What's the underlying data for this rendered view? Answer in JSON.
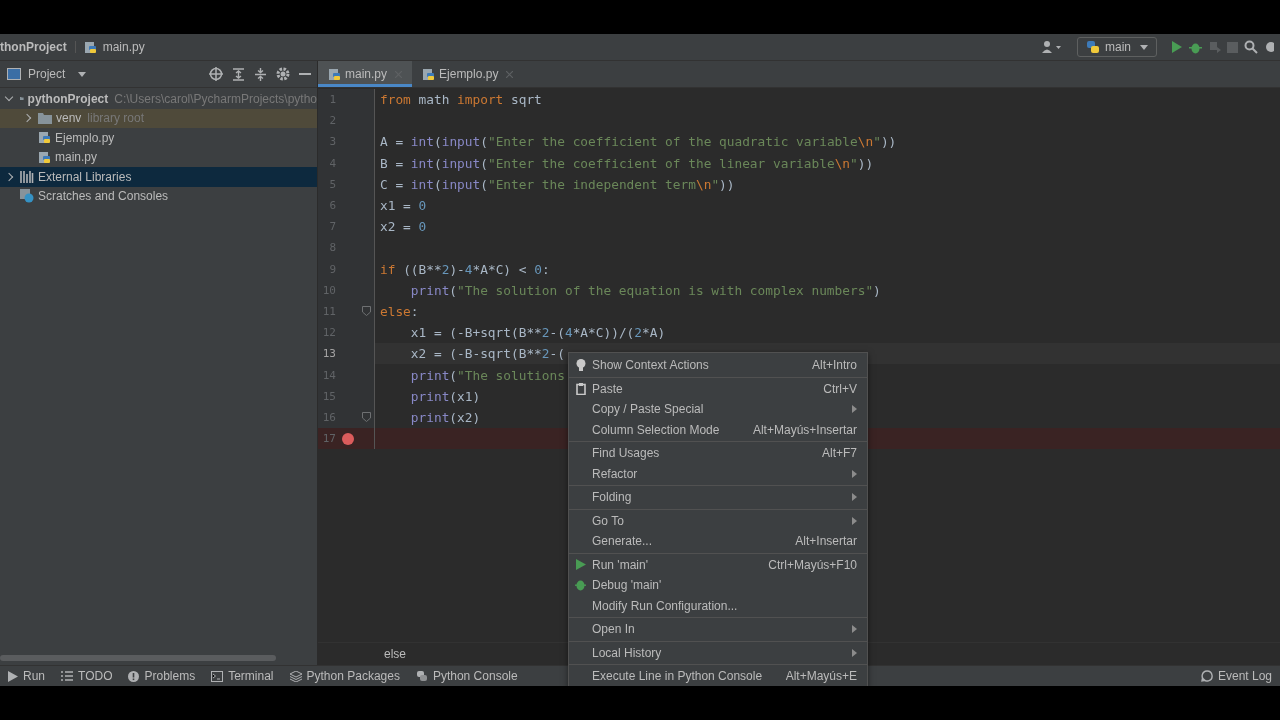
{
  "navbar": {
    "breadcrumb": [
      "thonProject",
      "main.py"
    ],
    "run_config": "main"
  },
  "project_panel": {
    "title": "Project",
    "tree": [
      {
        "label": "pythonProject",
        "path": "C:\\Users\\carol\\PycharmProjects\\pytho",
        "kind": "folder",
        "expanded": true,
        "selected": false,
        "children": [
          {
            "label": "venv",
            "note": "library root",
            "kind": "folder",
            "expanded": false,
            "selected": false
          },
          {
            "label": "Ejemplo.py",
            "kind": "python",
            "selected": false
          },
          {
            "label": "main.py",
            "kind": "python",
            "selected": false
          }
        ]
      },
      {
        "label": "External Libraries",
        "kind": "library",
        "expanded": false,
        "selected": true
      },
      {
        "label": "Scratches and Consoles",
        "kind": "scratch",
        "selected": false
      }
    ]
  },
  "tabs": [
    {
      "label": "main.py",
      "selected": true
    },
    {
      "label": "Ejemplo.py",
      "selected": false
    }
  ],
  "editor": {
    "lines": [
      {
        "number": "1",
        "current": false,
        "breakpoint": false,
        "fold": false,
        "tokens": [
          {
            "t": "from",
            "kind": "kw"
          },
          {
            "t": " math ",
            "kind": "plain"
          },
          {
            "t": "import",
            "kind": "kw"
          },
          {
            "t": " sqrt",
            "kind": "plain"
          }
        ]
      },
      {
        "number": "2",
        "current": false,
        "breakpoint": false,
        "fold": false
      },
      {
        "number": "3",
        "current": false,
        "breakpoint": false,
        "fold": false,
        "tokens": [
          {
            "t": "A = ",
            "kind": "plain"
          },
          {
            "t": "int",
            "kind": "fn"
          },
          {
            "t": "(",
            "kind": "plain"
          },
          {
            "t": "input",
            "kind": "fn"
          },
          {
            "t": "(",
            "kind": "plain"
          },
          {
            "t": "\"Enter the coefficient of the quadratic variable",
            "kind": "str"
          },
          {
            "t": "\\n",
            "kind": "esc"
          },
          {
            "t": "\"",
            "kind": "str"
          },
          {
            "t": "))",
            "kind": "plain"
          }
        ]
      },
      {
        "number": "4",
        "current": false,
        "breakpoint": false,
        "fold": false,
        "tokens": [
          {
            "t": "B = ",
            "kind": "plain"
          },
          {
            "t": "int",
            "kind": "fn"
          },
          {
            "t": "(",
            "kind": "plain"
          },
          {
            "t": "input",
            "kind": "fn"
          },
          {
            "t": "(",
            "kind": "plain"
          },
          {
            "t": "\"Enter the coefficient of the linear variable",
            "kind": "str"
          },
          {
            "t": "\\n",
            "kind": "esc"
          },
          {
            "t": "\"",
            "kind": "str"
          },
          {
            "t": "))",
            "kind": "plain"
          }
        ]
      },
      {
        "number": "5",
        "current": false,
        "breakpoint": false,
        "fold": false,
        "tokens": [
          {
            "t": "C = ",
            "kind": "plain"
          },
          {
            "t": "int",
            "kind": "fn"
          },
          {
            "t": "(",
            "kind": "plain"
          },
          {
            "t": "input",
            "kind": "fn"
          },
          {
            "t": "(",
            "kind": "plain"
          },
          {
            "t": "\"Enter the independent term",
            "kind": "str"
          },
          {
            "t": "\\n",
            "kind": "esc"
          },
          {
            "t": "\"",
            "kind": "str"
          },
          {
            "t": "))",
            "kind": "plain"
          }
        ]
      },
      {
        "number": "6",
        "current": false,
        "breakpoint": false,
        "fold": false,
        "tokens": [
          {
            "t": "x1 = ",
            "kind": "plain"
          },
          {
            "t": "0",
            "kind": "num"
          }
        ]
      },
      {
        "number": "7",
        "current": false,
        "breakpoint": false,
        "fold": false,
        "tokens": [
          {
            "t": "x2 = ",
            "kind": "plain"
          },
          {
            "t": "0",
            "kind": "num"
          }
        ]
      },
      {
        "number": "8",
        "current": false,
        "breakpoint": false,
        "fold": false
      },
      {
        "number": "9",
        "current": false,
        "breakpoint": false,
        "fold": false,
        "tokens": [
          {
            "t": "if",
            "kind": "kw"
          },
          {
            "t": " ((B**",
            "kind": "plain"
          },
          {
            "t": "2",
            "kind": "num"
          },
          {
            "t": ")-",
            "kind": "plain"
          },
          {
            "t": "4",
            "kind": "num"
          },
          {
            "t": "*A*C) < ",
            "kind": "plain"
          },
          {
            "t": "0",
            "kind": "num"
          },
          {
            "t": ":",
            "kind": "plain"
          }
        ]
      },
      {
        "number": "10",
        "current": false,
        "breakpoint": false,
        "fold": false,
        "tokens": [
          {
            "t": "    print",
            "kind": "fn"
          },
          {
            "t": "(",
            "kind": "plain"
          },
          {
            "t": "\"The solution of the equation is with complex numbers\"",
            "kind": "str"
          },
          {
            "t": ")",
            "kind": "plain"
          }
        ]
      },
      {
        "number": "11",
        "current": false,
        "breakpoint": false,
        "fold": true,
        "tokens": [
          {
            "t": "else",
            "kind": "kw"
          },
          {
            "t": ":",
            "kind": "plain"
          }
        ]
      },
      {
        "number": "12",
        "current": false,
        "breakpoint": false,
        "fold": false,
        "tokens": [
          {
            "t": "    x1 = (-B+sqrt(B**",
            "kind": "plain"
          },
          {
            "t": "2",
            "kind": "num"
          },
          {
            "t": "-(",
            "kind": "plain"
          },
          {
            "t": "4",
            "kind": "num"
          },
          {
            "t": "*A*C))/(",
            "kind": "plain"
          },
          {
            "t": "2",
            "kind": "num"
          },
          {
            "t": "*A)",
            "kind": "plain"
          }
        ]
      },
      {
        "number": "13",
        "current": true,
        "breakpoint": false,
        "fold": false,
        "tokens": [
          {
            "t": "    x2 = (-B-sqrt(B**",
            "kind": "plain"
          },
          {
            "t": "2",
            "kind": "num"
          },
          {
            "t": "-(",
            "kind": "plain"
          }
        ]
      },
      {
        "number": "14",
        "current": false,
        "breakpoint": false,
        "fold": false,
        "tokens": [
          {
            "t": "    print",
            "kind": "fn"
          },
          {
            "t": "(",
            "kind": "plain"
          },
          {
            "t": "\"The solutions",
            "kind": "str"
          }
        ]
      },
      {
        "number": "15",
        "current": false,
        "breakpoint": false,
        "fold": false,
        "tokens": [
          {
            "t": "    print",
            "kind": "fn"
          },
          {
            "t": "(x1)",
            "kind": "plain"
          }
        ]
      },
      {
        "number": "16",
        "current": false,
        "breakpoint": false,
        "fold": true,
        "tokens": [
          {
            "t": "    print",
            "kind": "fn"
          },
          {
            "t": "(x2)",
            "kind": "plain"
          }
        ]
      },
      {
        "number": "17",
        "current": false,
        "breakpoint": true,
        "fold": false
      }
    ],
    "breadcrumb": "else"
  },
  "context_menu": {
    "groups": [
      [
        {
          "label": "Show Context Actions",
          "shortcut": "Alt+Intro",
          "kind": "bulb",
          "submenu": false
        }
      ],
      [
        {
          "label": "Paste",
          "shortcut": "Ctrl+V",
          "kind": "clipboard",
          "submenu": false
        },
        {
          "label": "Copy / Paste Special",
          "submenu": true
        },
        {
          "label": "Column Selection Mode",
          "shortcut": "Alt+Mayús+Insertar",
          "submenu": false
        }
      ],
      [
        {
          "label": "Find Usages",
          "shortcut": "Alt+F7",
          "submenu": false
        },
        {
          "label": "Refactor",
          "submenu": true
        }
      ],
      [
        {
          "label": "Folding",
          "submenu": true
        }
      ],
      [
        {
          "label": "Go To",
          "submenu": true
        },
        {
          "label": "Generate...",
          "shortcut": "Alt+Insertar",
          "submenu": false
        }
      ],
      [
        {
          "label": "Run 'main'",
          "shortcut": "Ctrl+Mayús+F10",
          "kind": "run",
          "submenu": false
        },
        {
          "label": "Debug 'main'",
          "kind": "debug",
          "submenu": false
        },
        {
          "label": "Modify Run Configuration...",
          "submenu": false
        }
      ],
      [
        {
          "label": "Open In",
          "submenu": true
        }
      ],
      [
        {
          "label": "Local History",
          "submenu": true
        }
      ],
      [
        {
          "label": "Execute Line in Python Console",
          "shortcut": "Alt+Mayús+E",
          "submenu": false
        }
      ]
    ]
  },
  "tool_windows": [
    {
      "label": "Run",
      "kind": "run"
    },
    {
      "label": "TODO",
      "kind": "list"
    },
    {
      "label": "Problems",
      "kind": "info"
    },
    {
      "label": "Terminal",
      "kind": "terminal"
    },
    {
      "label": "Python Packages",
      "kind": "layers"
    },
    {
      "label": "Python Console",
      "kind": "python"
    }
  ],
  "event_log": "Event Log"
}
